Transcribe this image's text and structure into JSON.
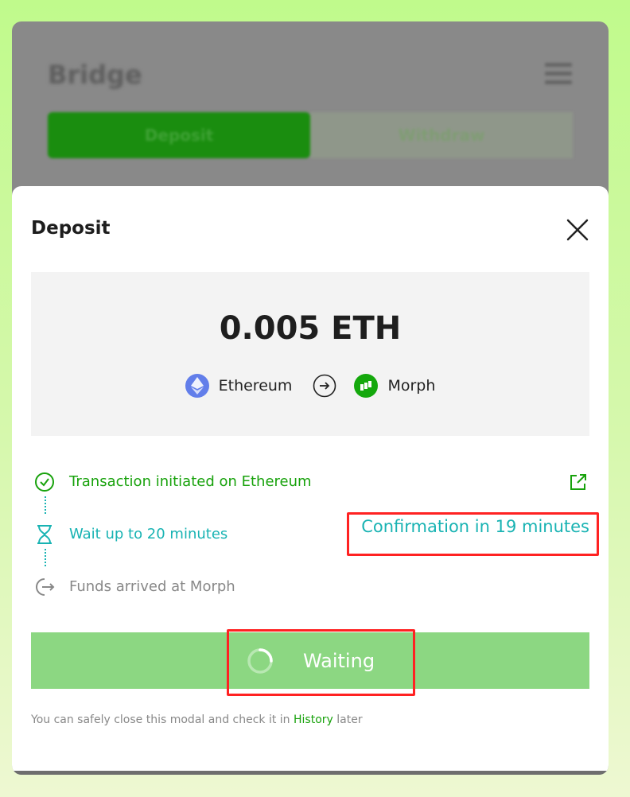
{
  "background": {
    "title": "Bridge",
    "tabs": [
      "Deposit",
      "Withdraw"
    ]
  },
  "modal": {
    "title": "Deposit",
    "amount": "0.005 ETH",
    "from_chain": "Ethereum",
    "to_chain": "Morph",
    "steps": [
      {
        "label": "Transaction initiated on Ethereum",
        "status": "done"
      },
      {
        "label": "Wait up to 20 minutes",
        "status": "pending"
      },
      {
        "label": "Funds arrived at Morph",
        "status": "todo"
      }
    ],
    "confirmation": "Confirmation in 19 minutes",
    "button_label": "Waiting",
    "footnote_prefix": "You can safely close this modal and check it in",
    "footnote_link": "History",
    "footnote_suffix": "later"
  },
  "colors": {
    "accent_green": "#18a20c",
    "teal": "#18b3b3",
    "button_green": "#8cd782",
    "highlight_red": "#ff2222"
  },
  "icons": [
    "ethereum-icon",
    "morph-icon",
    "arrow-right-circle-icon",
    "check-circle-icon",
    "hourglass-icon",
    "exit-arrow-icon",
    "external-link-icon",
    "close-icon",
    "spinner-icon",
    "menu-icon"
  ]
}
